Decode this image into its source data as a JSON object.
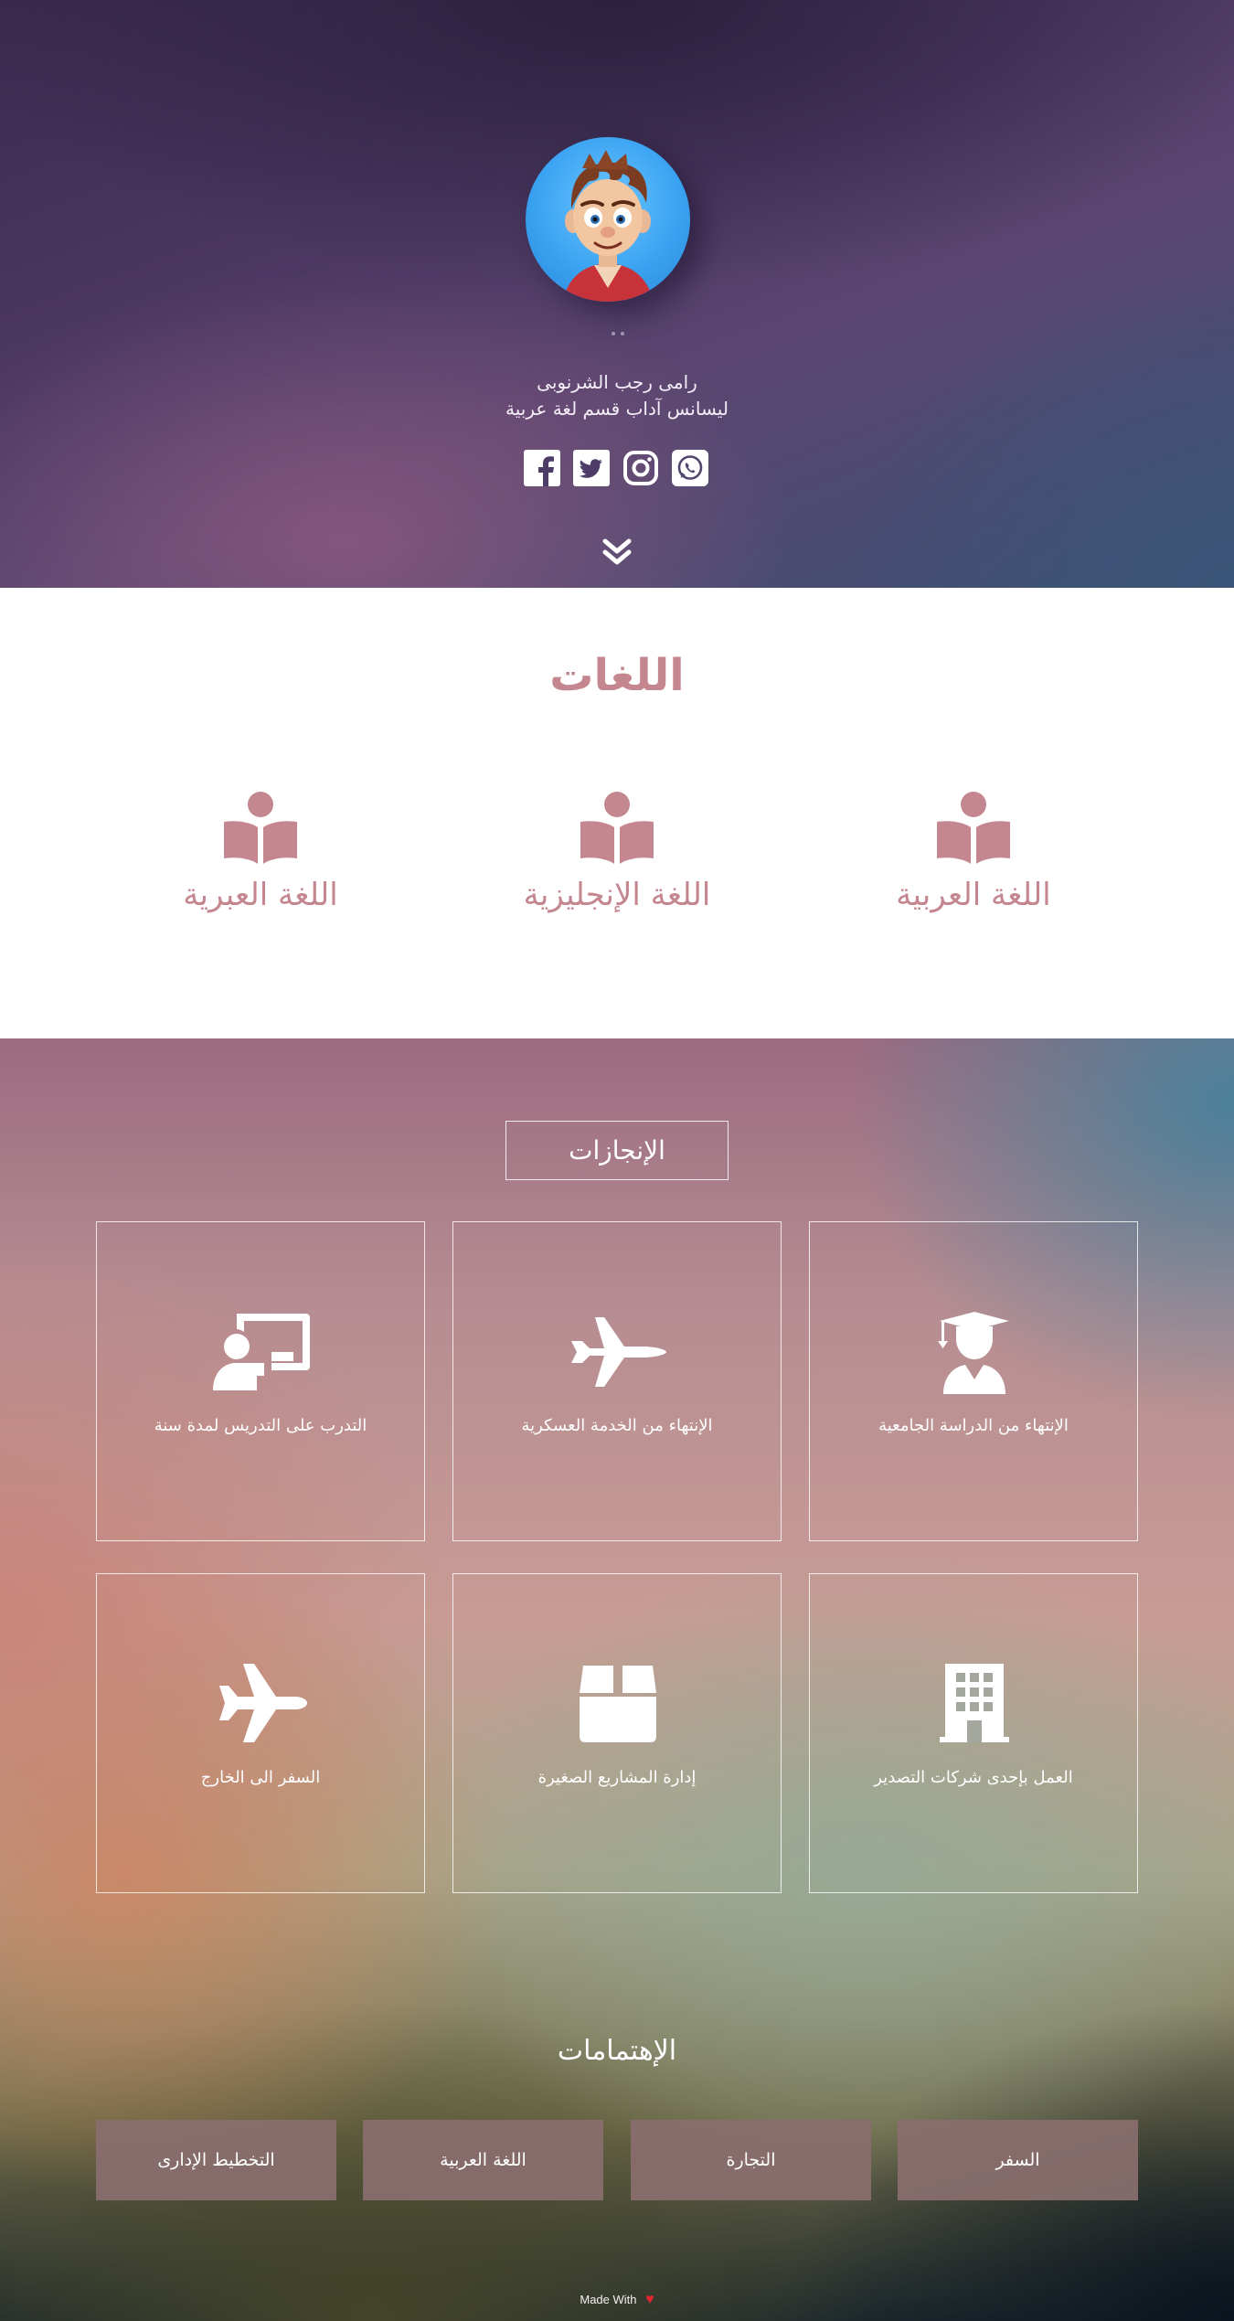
{
  "hero": {
    "name": "رامى رجب الشرنوبى",
    "title": "ليسانس آداب قسم لغة عربية",
    "socials": [
      {
        "icon": "facebook-icon"
      },
      {
        "icon": "twitter-icon"
      },
      {
        "icon": "instagram-icon"
      },
      {
        "icon": "whatsapp-icon"
      }
    ],
    "scroll_icon": "double-chevron-down-icon"
  },
  "languages": {
    "title": "اللغات",
    "items": [
      {
        "label": "اللغة العربية",
        "icon": "book-reader-icon"
      },
      {
        "label": "اللغة الإنجليزية",
        "icon": "book-reader-icon"
      },
      {
        "label": "اللغة العبرية",
        "icon": "book-reader-icon"
      }
    ]
  },
  "achievements": {
    "title": "الإنجازات",
    "items": [
      {
        "label": "الإنتهاء من الدراسة الجامعية",
        "icon": "graduate-icon"
      },
      {
        "label": "الإنتهاء من الخدمة العسكرية",
        "icon": "fighter-jet-icon"
      },
      {
        "label": "التدرب على التدريس لمدة سنة",
        "icon": "teacher-icon"
      },
      {
        "label": "العمل بإحدى شركات التصدير",
        "icon": "building-icon"
      },
      {
        "label": "إدارة المشاريع الصغيرة",
        "icon": "box-icon"
      },
      {
        "label": "السفر الى الخارج",
        "icon": "plane-icon"
      }
    ]
  },
  "interests": {
    "title": "الإهتمامات",
    "items": [
      "السفر",
      "التجارة",
      "اللغة العربية",
      "التخطيط الإدارى"
    ]
  },
  "footer": {
    "text": "Made With",
    "heart": "♥"
  },
  "colors": {
    "accent": "#c4878f",
    "interest_bg": "#886e6e"
  }
}
